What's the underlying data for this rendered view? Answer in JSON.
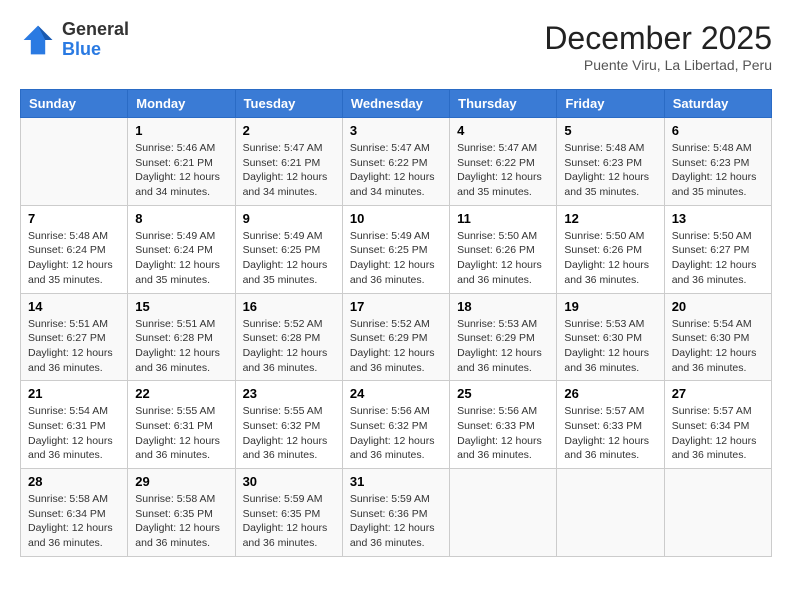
{
  "header": {
    "logo_general": "General",
    "logo_blue": "Blue",
    "month": "December 2025",
    "location": "Puente Viru, La Libertad, Peru"
  },
  "calendar": {
    "days_of_week": [
      "Sunday",
      "Monday",
      "Tuesday",
      "Wednesday",
      "Thursday",
      "Friday",
      "Saturday"
    ],
    "weeks": [
      [
        {
          "day": "",
          "info": ""
        },
        {
          "day": "1",
          "info": "Sunrise: 5:46 AM\nSunset: 6:21 PM\nDaylight: 12 hours\nand 34 minutes."
        },
        {
          "day": "2",
          "info": "Sunrise: 5:47 AM\nSunset: 6:21 PM\nDaylight: 12 hours\nand 34 minutes."
        },
        {
          "day": "3",
          "info": "Sunrise: 5:47 AM\nSunset: 6:22 PM\nDaylight: 12 hours\nand 34 minutes."
        },
        {
          "day": "4",
          "info": "Sunrise: 5:47 AM\nSunset: 6:22 PM\nDaylight: 12 hours\nand 35 minutes."
        },
        {
          "day": "5",
          "info": "Sunrise: 5:48 AM\nSunset: 6:23 PM\nDaylight: 12 hours\nand 35 minutes."
        },
        {
          "day": "6",
          "info": "Sunrise: 5:48 AM\nSunset: 6:23 PM\nDaylight: 12 hours\nand 35 minutes."
        }
      ],
      [
        {
          "day": "7",
          "info": "Sunrise: 5:48 AM\nSunset: 6:24 PM\nDaylight: 12 hours\nand 35 minutes."
        },
        {
          "day": "8",
          "info": "Sunrise: 5:49 AM\nSunset: 6:24 PM\nDaylight: 12 hours\nand 35 minutes."
        },
        {
          "day": "9",
          "info": "Sunrise: 5:49 AM\nSunset: 6:25 PM\nDaylight: 12 hours\nand 35 minutes."
        },
        {
          "day": "10",
          "info": "Sunrise: 5:49 AM\nSunset: 6:25 PM\nDaylight: 12 hours\nand 36 minutes."
        },
        {
          "day": "11",
          "info": "Sunrise: 5:50 AM\nSunset: 6:26 PM\nDaylight: 12 hours\nand 36 minutes."
        },
        {
          "day": "12",
          "info": "Sunrise: 5:50 AM\nSunset: 6:26 PM\nDaylight: 12 hours\nand 36 minutes."
        },
        {
          "day": "13",
          "info": "Sunrise: 5:50 AM\nSunset: 6:27 PM\nDaylight: 12 hours\nand 36 minutes."
        }
      ],
      [
        {
          "day": "14",
          "info": "Sunrise: 5:51 AM\nSunset: 6:27 PM\nDaylight: 12 hours\nand 36 minutes."
        },
        {
          "day": "15",
          "info": "Sunrise: 5:51 AM\nSunset: 6:28 PM\nDaylight: 12 hours\nand 36 minutes."
        },
        {
          "day": "16",
          "info": "Sunrise: 5:52 AM\nSunset: 6:28 PM\nDaylight: 12 hours\nand 36 minutes."
        },
        {
          "day": "17",
          "info": "Sunrise: 5:52 AM\nSunset: 6:29 PM\nDaylight: 12 hours\nand 36 minutes."
        },
        {
          "day": "18",
          "info": "Sunrise: 5:53 AM\nSunset: 6:29 PM\nDaylight: 12 hours\nand 36 minutes."
        },
        {
          "day": "19",
          "info": "Sunrise: 5:53 AM\nSunset: 6:30 PM\nDaylight: 12 hours\nand 36 minutes."
        },
        {
          "day": "20",
          "info": "Sunrise: 5:54 AM\nSunset: 6:30 PM\nDaylight: 12 hours\nand 36 minutes."
        }
      ],
      [
        {
          "day": "21",
          "info": "Sunrise: 5:54 AM\nSunset: 6:31 PM\nDaylight: 12 hours\nand 36 minutes."
        },
        {
          "day": "22",
          "info": "Sunrise: 5:55 AM\nSunset: 6:31 PM\nDaylight: 12 hours\nand 36 minutes."
        },
        {
          "day": "23",
          "info": "Sunrise: 5:55 AM\nSunset: 6:32 PM\nDaylight: 12 hours\nand 36 minutes."
        },
        {
          "day": "24",
          "info": "Sunrise: 5:56 AM\nSunset: 6:32 PM\nDaylight: 12 hours\nand 36 minutes."
        },
        {
          "day": "25",
          "info": "Sunrise: 5:56 AM\nSunset: 6:33 PM\nDaylight: 12 hours\nand 36 minutes."
        },
        {
          "day": "26",
          "info": "Sunrise: 5:57 AM\nSunset: 6:33 PM\nDaylight: 12 hours\nand 36 minutes."
        },
        {
          "day": "27",
          "info": "Sunrise: 5:57 AM\nSunset: 6:34 PM\nDaylight: 12 hours\nand 36 minutes."
        }
      ],
      [
        {
          "day": "28",
          "info": "Sunrise: 5:58 AM\nSunset: 6:34 PM\nDaylight: 12 hours\nand 36 minutes."
        },
        {
          "day": "29",
          "info": "Sunrise: 5:58 AM\nSunset: 6:35 PM\nDaylight: 12 hours\nand 36 minutes."
        },
        {
          "day": "30",
          "info": "Sunrise: 5:59 AM\nSunset: 6:35 PM\nDaylight: 12 hours\nand 36 minutes."
        },
        {
          "day": "31",
          "info": "Sunrise: 5:59 AM\nSunset: 6:36 PM\nDaylight: 12 hours\nand 36 minutes."
        },
        {
          "day": "",
          "info": ""
        },
        {
          "day": "",
          "info": ""
        },
        {
          "day": "",
          "info": ""
        }
      ]
    ]
  }
}
